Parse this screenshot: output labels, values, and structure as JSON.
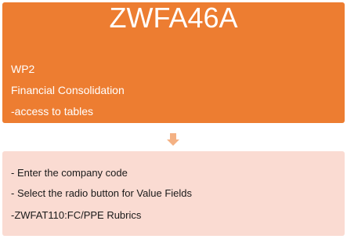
{
  "top_box": {
    "title": "ZWFA46A",
    "lines": [
      "WP2",
      "Financial Consolidation",
      "-access to tables"
    ],
    "color": "#ed7d31"
  },
  "arrow": {
    "icon": "down-arrow-icon",
    "color": "#f4b183"
  },
  "bottom_box": {
    "lines": [
      "- Enter the company code",
      "- Select the radio button for Value Fields",
      "-ZWFAT110:FC/PPE Rubrics"
    ],
    "color": "#fadbd2"
  }
}
